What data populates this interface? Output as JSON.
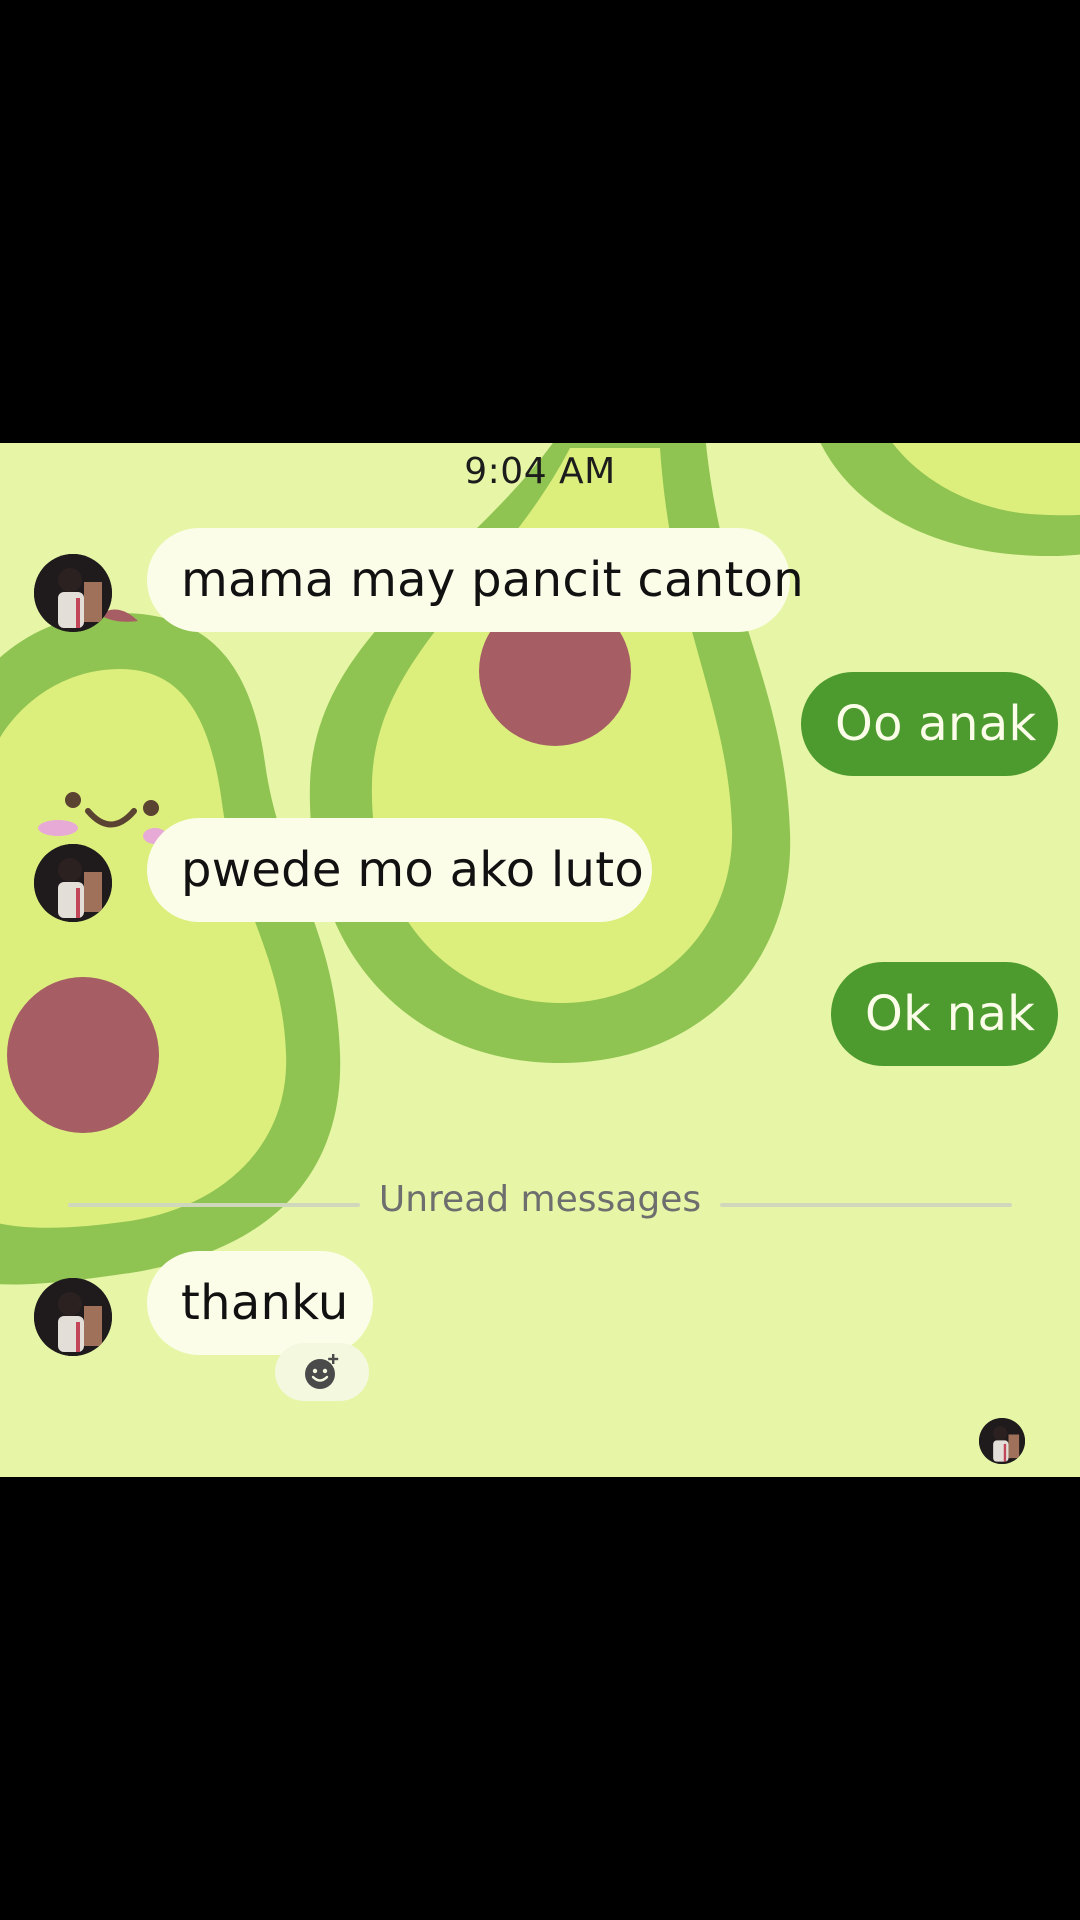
{
  "chat": {
    "timestamp": "9:04 AM",
    "messages": [
      {
        "direction": "incoming",
        "text": "mama may pancit canton"
      },
      {
        "direction": "outgoing",
        "text": "Oo anak"
      },
      {
        "direction": "incoming",
        "text": "pwede mo ako luto"
      },
      {
        "direction": "outgoing",
        "text": "Ok nak"
      },
      {
        "direction": "incoming",
        "text": "thanku"
      }
    ],
    "unread_divider": "Unread messages"
  },
  "icons": {
    "avatar": "contact-avatar",
    "react": "add-reaction-icon",
    "read_receipt": "read-receipt-avatar"
  },
  "colors": {
    "chat_background": "#e6f6a6",
    "incoming_bubble": "#fbfde9",
    "outgoing_bubble": "#4d9a2f",
    "outgoing_text": "#fbfde9"
  }
}
